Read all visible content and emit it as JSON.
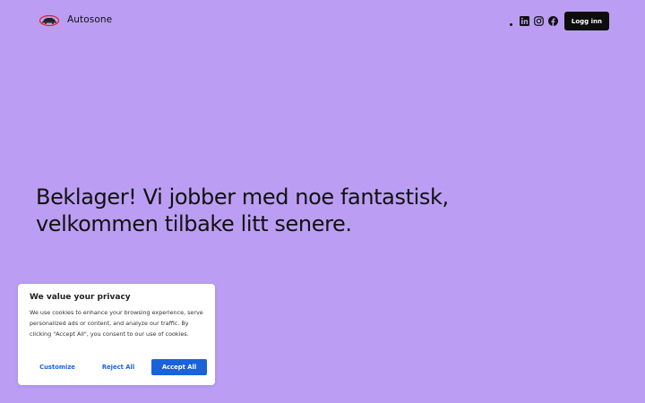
{
  "header": {
    "brand_name": "Autosone",
    "login_label": "Logg inn",
    "social": [
      {
        "icon": "linkedin-icon"
      },
      {
        "icon": "instagram-icon"
      },
      {
        "icon": "facebook-icon"
      }
    ]
  },
  "main": {
    "headline_line1": "Beklager! Vi jobber med noe fantastisk,",
    "headline_line2": "velkommen tilbake litt senere."
  },
  "cookie_banner": {
    "title": "We value your privacy",
    "text": "We use cookies to enhance your browsing experience, serve personalized ads or content, and analyze our traffic. By clicking \"Accept All\", you consent to our use of cookies.",
    "customize_label": "Customize",
    "reject_label": "Reject All",
    "accept_label": "Accept All"
  },
  "colors": {
    "background": "#bb9ef3",
    "button_dark": "#0d0d0d",
    "accent_blue": "#1863dc"
  }
}
